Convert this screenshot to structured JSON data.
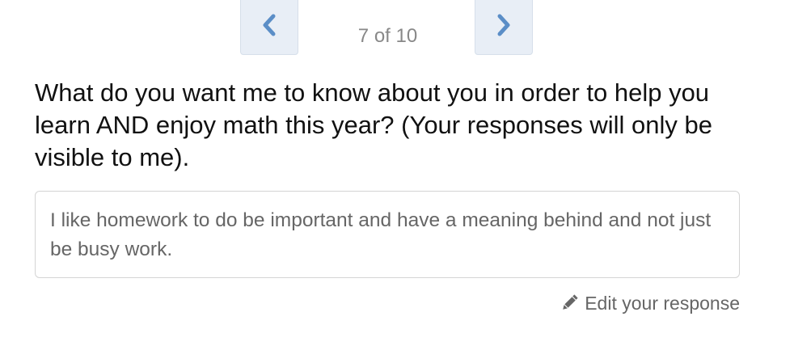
{
  "pagination": {
    "prev_icon": "chevron-left-icon",
    "next_icon": "chevron-right-icon",
    "counter": "7 of 10",
    "current": 7,
    "total": 10
  },
  "question": {
    "text": "What do you want me to know about you in order to help you learn AND enjoy math this year? (Your responses will only be visible to me)."
  },
  "response": {
    "text": "I like homework to do be important and have a meaning behind and not just be busy work."
  },
  "edit": {
    "icon": "pencil-icon",
    "label": "Edit your response"
  },
  "colors": {
    "nav_button_bg": "#e8eef6",
    "chevron": "#5b8ec7",
    "muted_text": "#888888",
    "body_text": "#111111"
  }
}
